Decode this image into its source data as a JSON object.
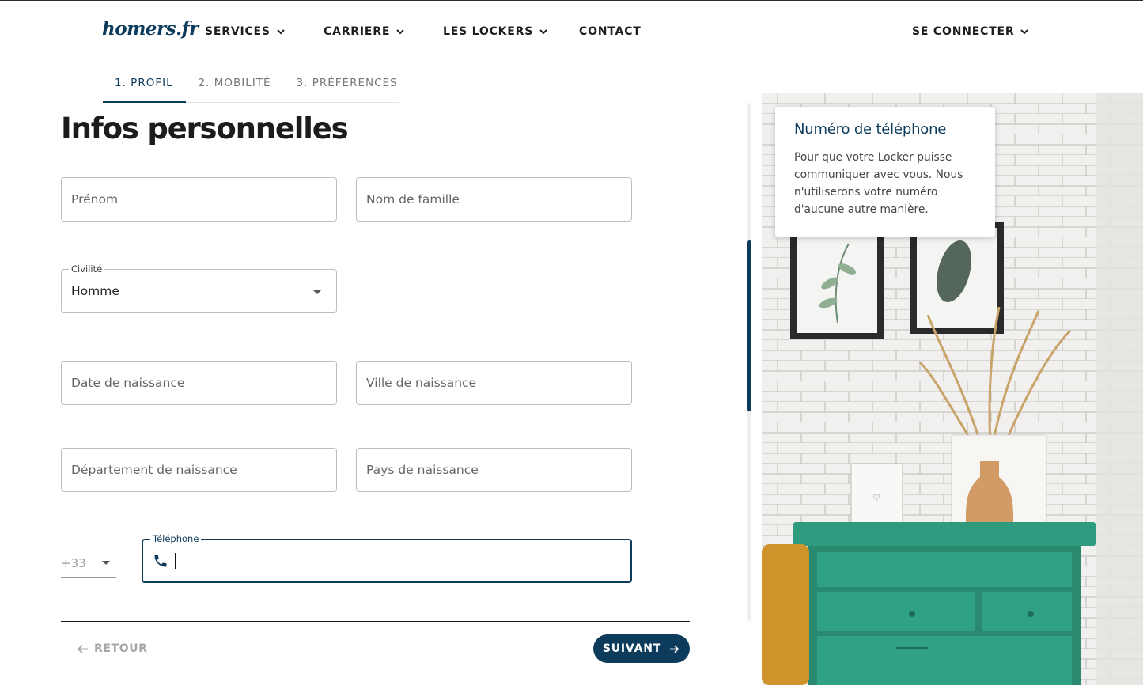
{
  "logo": "homers.fr",
  "nav": {
    "services": "SERVICES",
    "carriere": "CARRIERE",
    "lockers": "LES LOCKERS",
    "contact": "CONTACT",
    "connect": "SE CONNECTER"
  },
  "steps": [
    "1. PROFIL",
    "2. MOBILITÉ",
    "3. PRÉFÉRENCES"
  ],
  "title": "Infos personnelles",
  "form": {
    "firstname_placeholder": "Prénom",
    "lastname_placeholder": "Nom de famille",
    "civility_label": "Civilité",
    "civility_value": "Homme",
    "birthdate_placeholder": "Date de naissance",
    "birthcity_placeholder": "Ville de naissance",
    "birthdept_placeholder": "Département de naissance",
    "birthcountry_placeholder": "Pays de naissance",
    "phone_prefix": "+33",
    "phone_label": "Téléphone"
  },
  "footer": {
    "back": "RETOUR",
    "next": "SUIVANT"
  },
  "tooltip": {
    "title": "Numéro de téléphone",
    "body": "Pour que votre Locker puisse communiquer avec vous. Nous n'utiliserons votre numéro d'aucune autre manière."
  },
  "colors": {
    "primary": "#0d3b5c",
    "furniture": "#2e9a7e"
  }
}
